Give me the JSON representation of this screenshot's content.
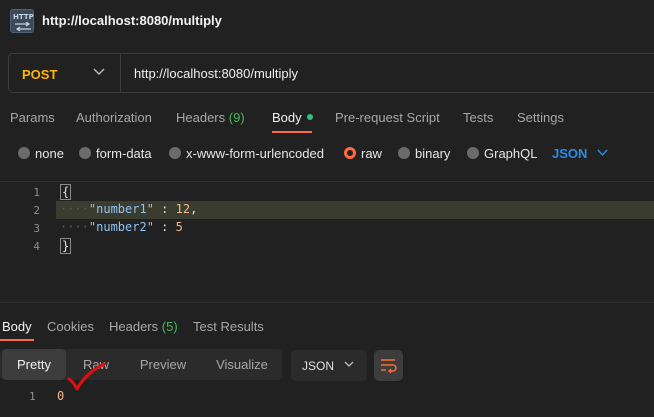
{
  "header": {
    "title": "http://localhost:8080/multiply",
    "icon": "http-icon"
  },
  "request": {
    "method": "POST",
    "url": "http://localhost:8080/multiply",
    "tabs": [
      {
        "label": "Params"
      },
      {
        "label": "Authorization"
      },
      {
        "label": "Headers",
        "count": "(9)"
      },
      {
        "label": "Body"
      },
      {
        "label": "Pre-request Script"
      },
      {
        "label": "Tests"
      },
      {
        "label": "Settings"
      }
    ],
    "body_types": [
      "none",
      "form-data",
      "x-www-form-urlencoded",
      "raw",
      "binary",
      "GraphQL"
    ],
    "selected_body_type": "raw",
    "format": "JSON",
    "lines": [
      {
        "n": "1",
        "text": "{"
      },
      {
        "n": "2",
        "key": "\"number1\"",
        "sep": " : ",
        "value": "12",
        "tail": ","
      },
      {
        "n": "3",
        "key": "\"number2\"",
        "sep": " : ",
        "value": "5"
      },
      {
        "n": "4",
        "text": "}"
      }
    ]
  },
  "response": {
    "tabs": [
      {
        "label": "Body"
      },
      {
        "label": "Cookies"
      },
      {
        "label": "Headers",
        "count": "(5)"
      },
      {
        "label": "Test Results"
      }
    ],
    "views": [
      "Pretty",
      "Raw",
      "Preview",
      "Visualize"
    ],
    "format": "JSON",
    "line_number": "1",
    "value": "0"
  },
  "colors": {
    "accent": "#ff6c37",
    "method": "#ffb400",
    "link": "#2b8ce6",
    "count": "#49b85c",
    "annotation": "#e01010"
  }
}
